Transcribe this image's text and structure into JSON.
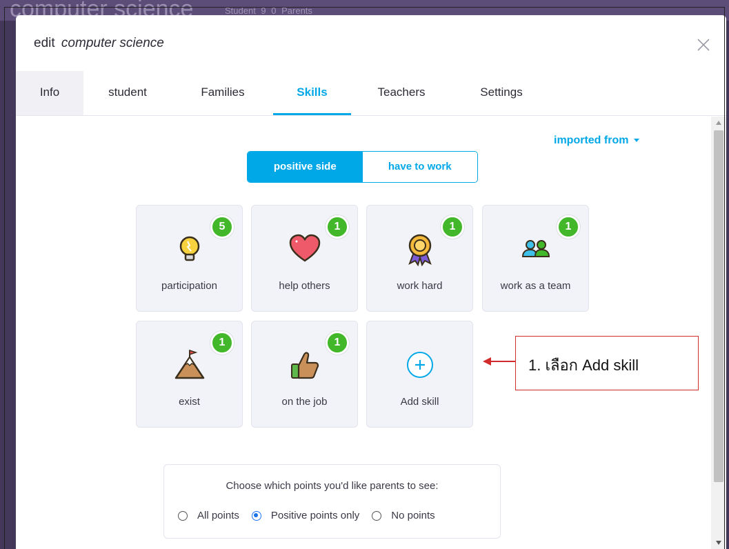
{
  "background": {
    "page_title": "computer science",
    "meta": "Student 9   0 Parents"
  },
  "modal": {
    "title_prefix": "edit",
    "title_name": "computer science"
  },
  "tabs": [
    {
      "label": "Info"
    },
    {
      "label": "student"
    },
    {
      "label": "Families"
    },
    {
      "label": "Skills"
    },
    {
      "label": "Teachers"
    },
    {
      "label": "Settings"
    }
  ],
  "active_tab": "Skills",
  "imported_from": "imported from",
  "segmented": {
    "positive_label": "positive side",
    "negative_label": "have to work",
    "selected": "positive side"
  },
  "skills": [
    {
      "label": "participation",
      "count": "5",
      "icon": "lightbulb-icon"
    },
    {
      "label": "help others",
      "count": "1",
      "icon": "heart-icon"
    },
    {
      "label": "work hard",
      "count": "1",
      "icon": "award-ribbon-icon"
    },
    {
      "label": "work as a team",
      "count": "1",
      "icon": "team-people-icon"
    },
    {
      "label": "exist",
      "count": "1",
      "icon": "mountain-flag-icon"
    },
    {
      "label": "on the job",
      "count": "1",
      "icon": "thumbs-up-icon"
    }
  ],
  "add_skill_label": "Add skill",
  "parents_visibility": {
    "question": "Choose which points you'd like parents to see:",
    "options": [
      "All points",
      "Positive points only",
      "No points"
    ],
    "selected": "Positive points only"
  },
  "annotation": {
    "text": "1. เลือก Add skill"
  },
  "colors": {
    "accent": "#00a8e8",
    "badge": "#42b72a",
    "annotation_border": "#d12b2b"
  }
}
